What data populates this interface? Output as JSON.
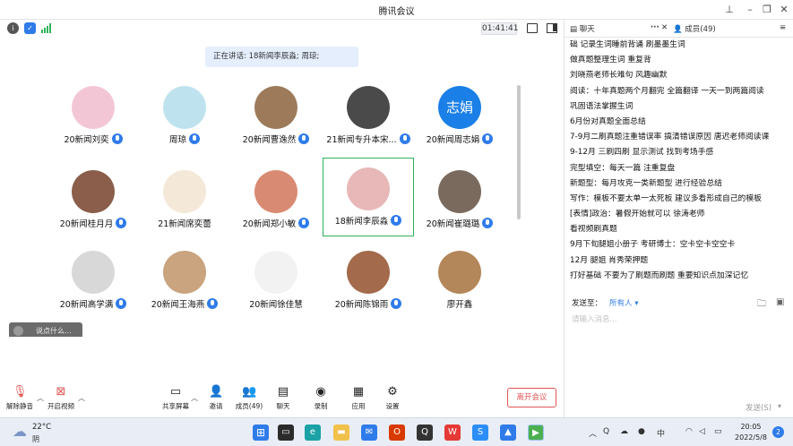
{
  "window": {
    "title": "腾讯会议"
  },
  "meeting": {
    "timer": "01:41:41",
    "speaking": "正在讲话: 18新闻李辰淼; 周琼;"
  },
  "participants": [
    {
      "name": "20新闻刘奕",
      "mic": true,
      "avatar_color": "#f3c6d6",
      "avatar_text": ""
    },
    {
      "name": "周琼",
      "mic": true,
      "avatar_color": "#bfe3ee",
      "avatar_text": ""
    },
    {
      "name": "20新闻曹逸然",
      "mic": true,
      "avatar_color": "#9c7a5a",
      "avatar_text": ""
    },
    {
      "name": "21新闻专升本宋...",
      "mic": true,
      "avatar_color": "#4a4a4a",
      "avatar_text": ""
    },
    {
      "name": "20新闻周志娟",
      "mic": true,
      "avatar_color": "#1a7fe6",
      "avatar_text": "志娟"
    },
    {
      "name": "20新闻桂月月",
      "mic": true,
      "avatar_color": "#8a5e4a",
      "avatar_text": ""
    },
    {
      "name": "21新闻席奕蕾",
      "mic": false,
      "avatar_color": "#f4e9d8",
      "avatar_text": ""
    },
    {
      "name": "20新闻郑小敏",
      "mic": true,
      "avatar_color": "#d98a72",
      "avatar_text": ""
    },
    {
      "name": "18新闻李辰淼",
      "mic": true,
      "avatar_color": "#e8b8b8",
      "avatar_text": ""
    },
    {
      "name": "20新闻崔璐璐",
      "mic": true,
      "avatar_color": "#7a6a5e",
      "avatar_text": ""
    },
    {
      "name": "20新闻高学满",
      "mic": true,
      "avatar_color": "#d8d8d8",
      "avatar_text": ""
    },
    {
      "name": "20新闻王海燕",
      "mic": true,
      "avatar_color": "#c9a47e",
      "avatar_text": ""
    },
    {
      "name": "20新闻徐佳慧",
      "mic": false,
      "avatar_color": "#f2f2f2",
      "avatar_text": ""
    },
    {
      "name": "20新闻陈锦雨",
      "mic": true,
      "avatar_color": "#a36a4c",
      "avatar_text": ""
    },
    {
      "name": "廖开鑫",
      "mic": false,
      "avatar_color": "#b3875a",
      "avatar_text": ""
    }
  ],
  "chat_input_placeholder": "说点什么...",
  "toolbar": {
    "mute": "解除静音",
    "video": "开启视频",
    "share": "共享屏幕",
    "invite": "邀请",
    "members": "成员(49)",
    "chat": "聊天",
    "record": "录制",
    "apps": "应用",
    "settings": "设置",
    "leave": "离开会议"
  },
  "side": {
    "chat_tab": "聊天",
    "members_tab": "成员(49)",
    "messages": [
      "础 记录生词睡前背诵 刷墨墨生词",
      "做真题整理生词 重复背",
      "刘晓燕老师长难句 风趣幽默",
      "阅读：十年真题两个月翻完 全篇翻译 一天一到两篇阅读",
      "巩固语法掌握生词",
      "6月份对真题全面总结",
      "7-9月二刷真题注重错误率 搞清错误原因 唐迟老师阅读课",
      "9-12月 三刷四刷 显示测试 找到考场手感",
      "完型填空：每天一篇 注重复盘",
      "新题型：每月攻克一类新题型 进行经验总结",
      "写作：模板不要太单一太死板 建议多看形成自己的模板",
      "[表情]政治：暑假开始就可以 徐涛老师",
      "看视频刷真题",
      "9月下旬腿姐小册子 考研博士：空卡空卡空空卡",
      "12月 腿姐 肖秀荣押题",
      "打好基础 不要为了刷题而刷题 重要知识点加深记忆"
    ],
    "send_to_label": "发送至：",
    "send_to_value": "所有人",
    "input_placeholder": "请输入消息...",
    "send_button": "发送(S)"
  },
  "taskbar": {
    "weather_temp": "22°C",
    "weather_desc": "阴",
    "time": "20:05",
    "date": "2022/5/8",
    "notification_count": "2",
    "ime": "中"
  }
}
